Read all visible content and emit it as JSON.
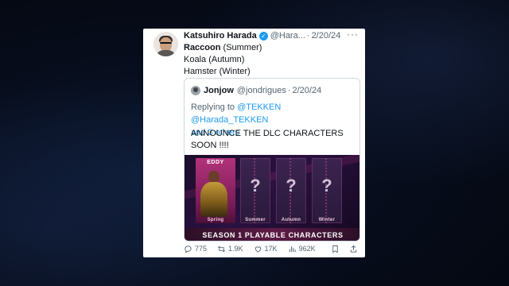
{
  "tweet": {
    "author_name": "Katsuhiro Harada",
    "verified_icon": "verified-badge-icon",
    "handle": "@Hara...",
    "dot": "·",
    "date": "2/20/24",
    "more_icon": "···",
    "lines": [
      {
        "bold": "Raccoon",
        "rest": " (Summer)"
      },
      {
        "bold": "",
        "rest": "Koala (Autumn)"
      },
      {
        "bold": "",
        "rest": "Hamster (Winter)"
      }
    ]
  },
  "quote": {
    "author_name": "Jonjow",
    "handle": "@jondrigues",
    "dot": "·",
    "date": "2/20/24",
    "replying_prefix": "Replying to ",
    "replying_links": "@TEKKEN @Harada_TEKKEN",
    "replying_more": "and 3 others",
    "text": "ANNOUNCE THE DLC CHARACTERS SOON !!!!",
    "image": {
      "fighter_name": "EDDY",
      "seasons": [
        "Spring",
        "Summer",
        "Autumn",
        "Winter"
      ],
      "placeholder": "?",
      "banner": "SEASON 1  PLAYABLE CHARACTERS"
    }
  },
  "actions": {
    "replies": "775",
    "retweets": "1.9K",
    "likes": "17K",
    "views": "962K"
  },
  "colors": {
    "link": "#1d9bf0",
    "muted": "#536471",
    "text": "#0f1419",
    "accent_pink": "#b3337a"
  }
}
